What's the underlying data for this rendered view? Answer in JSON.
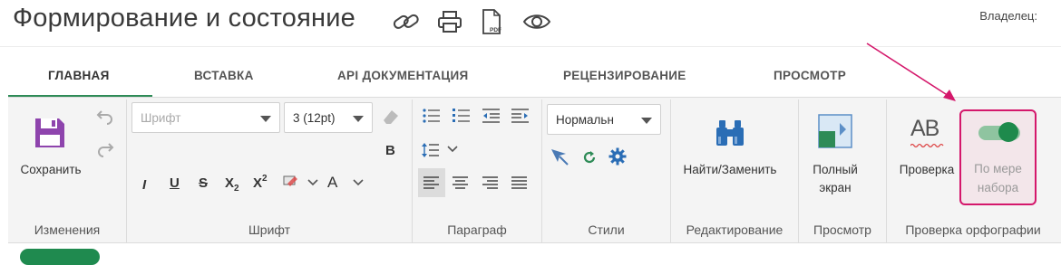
{
  "header": {
    "title": "Формирование и состояние",
    "owner_label": "Владелец:",
    "icons": [
      "link-icon",
      "print-icon",
      "pdf-icon",
      "eye-icon"
    ],
    "pdf_text": "PDF"
  },
  "tabs": [
    {
      "label": "ГЛАВНАЯ",
      "active": true
    },
    {
      "label": "ВСТАВКА"
    },
    {
      "label": "API ДОКУМЕНТАЦИЯ"
    },
    {
      "label": "РЕЦЕНЗИРОВАНИЕ"
    },
    {
      "label": "ПРОСМОТР"
    }
  ],
  "ribbon": {
    "changes": {
      "save_label": "Сохранить",
      "group_label": "Изменения"
    },
    "font": {
      "font_placeholder": "Шрифт",
      "size_value": "3 (12pt)",
      "bold": "B",
      "italic": "I",
      "underline": "U",
      "strike": "S",
      "subscript": "X",
      "subscript_mark": "2",
      "superscript": "X",
      "superscript_mark": "2",
      "font_color_glyph": "A",
      "group_label": "Шрифт"
    },
    "paragraph": {
      "group_label": "Параграф"
    },
    "styles": {
      "style_value": "Нормальн",
      "group_label": "Стили"
    },
    "editing": {
      "find_replace_label": "Найти/Заменить",
      "group_label": "Редактирование"
    },
    "view": {
      "fullscreen_line1": "Полный",
      "fullscreen_line2": "экран",
      "group_label": "Просмотр"
    },
    "spelling": {
      "check_icon_text": "AB",
      "check_label": "Проверка",
      "as_you_type_line1": "По мере",
      "as_you_type_line2": "набора",
      "as_you_type_enabled": true,
      "group_label": "Проверка орфографии"
    }
  },
  "colors": {
    "accent_green": "#2e8b57",
    "highlight_border": "#d4176b",
    "save_icon": "#8e44ad",
    "binoculars": "#2a6db5",
    "arrow": "#d4176b"
  }
}
